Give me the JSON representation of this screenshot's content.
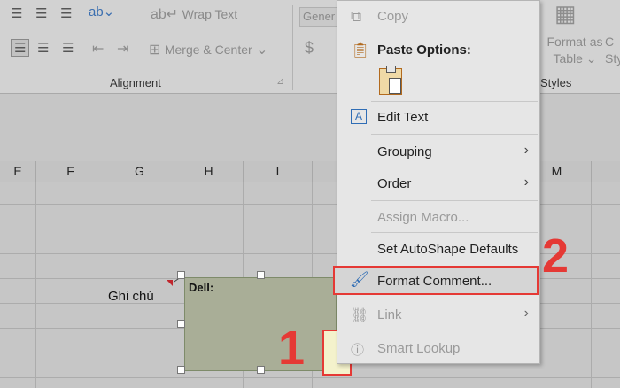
{
  "ribbon": {
    "wrap_text": "Wrap Text",
    "merge_center": "Merge & Center",
    "number_format": "Gener",
    "currency_symbol": "$",
    "alignment_group": "Alignment",
    "format_as_table_line1": "Format as",
    "format_as_table_line2": "Table",
    "cell_styles_partial_1": "C",
    "cell_styles_partial_2": "Sty",
    "styles_group": "Styles"
  },
  "sheet": {
    "columns": [
      "E",
      "F",
      "G",
      "H",
      "I",
      "M"
    ],
    "cell_note_label": "Ghi chú"
  },
  "comment": {
    "author": "Dell:"
  },
  "context_menu": {
    "copy": "Copy",
    "paste_options": "Paste Options:",
    "edit_text": "Edit Text",
    "grouping": "Grouping",
    "order": "Order",
    "assign_macro": "Assign Macro...",
    "set_autoshape_defaults": "Set AutoShape Defaults",
    "format_comment": "Format Comment...",
    "link": "Link",
    "smart_lookup": "Smart Lookup"
  },
  "annotations": {
    "step1": "1",
    "step2": "2"
  },
  "colors": {
    "highlight": "#e53935",
    "comment_fill": "#a9ae97",
    "note_indicator": "#c0262d"
  }
}
